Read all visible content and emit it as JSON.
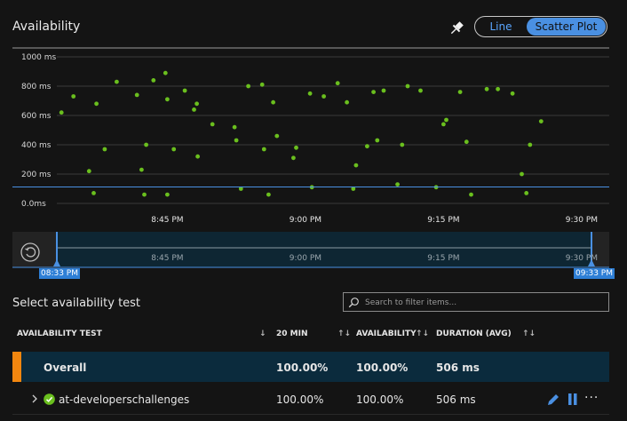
{
  "header": {
    "title": "Availability",
    "toggle": {
      "line_label": "Line",
      "scatter_label": "Scatter Plot",
      "selected": "Scatter Plot"
    }
  },
  "chart_data": {
    "type": "scatter",
    "title": "",
    "xlabel": "",
    "ylabel": "",
    "y_tick_labels": [
      "1000 ms",
      "800 ms",
      "600 ms",
      "400 ms",
      "200 ms",
      "0.0ms"
    ],
    "x_tick_labels": [
      "8:45 PM",
      "9:00 PM",
      "9:15 PM",
      "9:30 PM"
    ],
    "ylim": [
      0,
      1000
    ],
    "xlim_minutes_after_8pm": [
      33,
      93
    ],
    "grid": true,
    "point_color": "#6abf1e",
    "series": [
      {
        "points": [
          [
            33.5,
            620
          ],
          [
            34.8,
            730
          ],
          [
            36.5,
            220
          ],
          [
            37,
            70
          ],
          [
            37.3,
            680
          ],
          [
            38.2,
            370
          ],
          [
            39.5,
            830
          ],
          [
            41.7,
            740
          ],
          [
            42.2,
            230
          ],
          [
            42.5,
            60
          ],
          [
            42.7,
            400
          ],
          [
            43.5,
            840
          ],
          [
            44.8,
            890
          ],
          [
            45,
            710
          ],
          [
            45,
            60
          ],
          [
            45.7,
            370
          ],
          [
            46.9,
            770
          ],
          [
            47.9,
            640
          ],
          [
            48.2,
            680
          ],
          [
            48.3,
            320
          ],
          [
            49.9,
            540
          ],
          [
            52.3,
            520
          ],
          [
            52.5,
            430
          ],
          [
            53,
            100
          ],
          [
            53.8,
            800
          ],
          [
            55.3,
            810
          ],
          [
            55.5,
            370
          ],
          [
            56,
            60
          ],
          [
            56.5,
            690
          ],
          [
            56.9,
            460
          ],
          [
            58.7,
            310
          ],
          [
            59,
            380
          ],
          [
            60.5,
            750
          ],
          [
            60.7,
            110
          ],
          [
            62,
            730
          ],
          [
            63.5,
            820
          ],
          [
            64.5,
            690
          ],
          [
            65.2,
            100
          ],
          [
            65.5,
            260
          ],
          [
            66.7,
            390
          ],
          [
            67.4,
            760
          ],
          [
            67.8,
            430
          ],
          [
            68.5,
            770
          ],
          [
            70,
            130
          ],
          [
            70.5,
            400
          ],
          [
            71.1,
            800
          ],
          [
            72.5,
            770
          ],
          [
            74.2,
            110
          ],
          [
            75,
            540
          ],
          [
            75.3,
            570
          ],
          [
            76.8,
            760
          ],
          [
            77.5,
            420
          ],
          [
            78,
            60
          ],
          [
            79.7,
            780
          ],
          [
            80.9,
            780
          ],
          [
            82.5,
            750
          ],
          [
            83.5,
            200
          ],
          [
            84,
            70
          ],
          [
            84.4,
            400
          ],
          [
            85.6,
            560
          ]
        ]
      }
    ],
    "range_selector": {
      "x_tick_labels": [
        "8:45 PM",
        "9:00 PM",
        "9:15 PM",
        "9:30 PM"
      ],
      "start_label": "08:33 PM",
      "end_label": "09:33 PM"
    }
  },
  "tests": {
    "section_title": "Select availability test",
    "search_placeholder": "Search to filter items...",
    "columns": {
      "test": "AVAILABILITY TEST",
      "twenty_min": "20 MIN",
      "availability": "AVAILABILITY",
      "duration": "DURATION (AVG)"
    },
    "sort_glyph_single": "↓",
    "sort_glyph": "↑↓",
    "overall": {
      "name": "Overall",
      "twenty_min": "100.00%",
      "availability": "100.00%",
      "duration": "506 ms"
    },
    "rows": [
      {
        "name": "at-developerschallenges",
        "twenty_min": "100.00%",
        "availability": "100.00%",
        "duration": "506 ms"
      }
    ],
    "more_glyph": "···"
  },
  "colors": {
    "accent": "#4a90e2",
    "overall_marker": "#f2860f",
    "status_ok": "#6abf1e"
  },
  "icons": [
    "pin-icon",
    "reset-zoom-icon",
    "search-icon",
    "chevron-right-icon",
    "check-circle-icon",
    "edit-icon",
    "pause-icon",
    "more-icon"
  ]
}
